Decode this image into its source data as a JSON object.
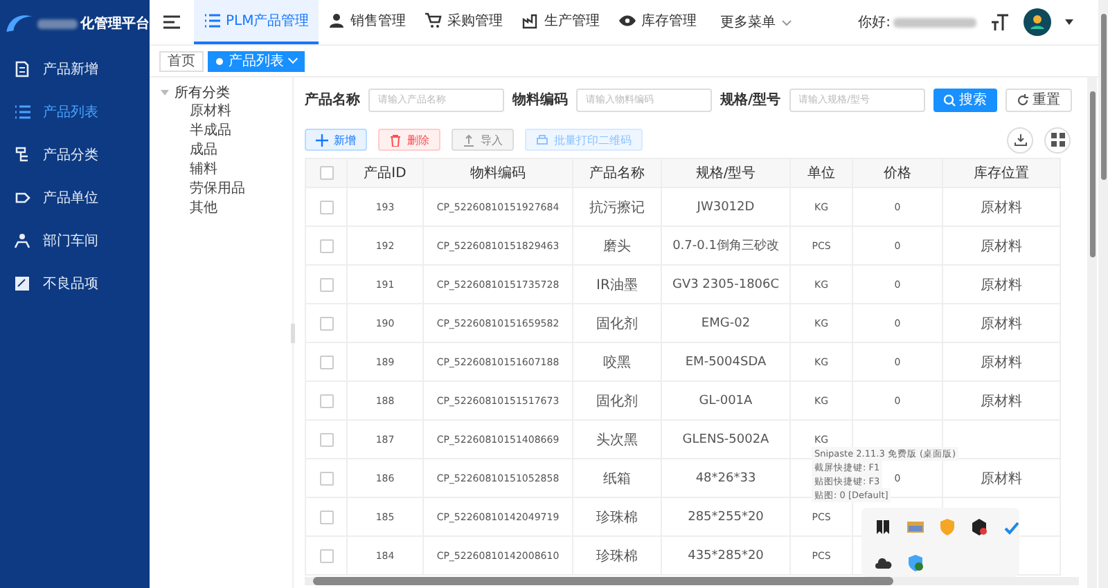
{
  "sidebar": {
    "logo_text": "化管理平台",
    "items": [
      {
        "label": "产品新增",
        "selected": false
      },
      {
        "label": "产品列表",
        "selected": true
      },
      {
        "label": "产品分类",
        "selected": false
      },
      {
        "label": "产品单位",
        "selected": false
      },
      {
        "label": "部门车间",
        "selected": false
      },
      {
        "label": "不良品项",
        "selected": false
      }
    ]
  },
  "topnav": {
    "items": [
      {
        "label": "PLM产品管理",
        "selected": true
      },
      {
        "label": "销售管理",
        "selected": false
      },
      {
        "label": "采购管理",
        "selected": false
      },
      {
        "label": "生产管理",
        "selected": false
      },
      {
        "label": "库存管理",
        "selected": false
      }
    ],
    "more_menu": "更多菜单",
    "greeting": "你好:"
  },
  "tabs": [
    {
      "label": "首页",
      "selected": false
    },
    {
      "label": "产品列表",
      "selected": true
    }
  ],
  "tree": {
    "label": "所有分类",
    "expanded": true,
    "children": [
      {
        "label": "原材料"
      },
      {
        "label": "半成品"
      },
      {
        "label": "成品"
      },
      {
        "label": "辅料"
      },
      {
        "label": "劳保用品"
      },
      {
        "label": "其他"
      }
    ]
  },
  "search": {
    "fields": [
      {
        "label": "产品名称",
        "placeholder": "请输入产品名称"
      },
      {
        "label": "物料编码",
        "placeholder": "请输入物料编码"
      },
      {
        "label": "规格/型号",
        "placeholder": "请输入规格/型号"
      }
    ],
    "search_button": "搜索",
    "reset_button": "重置"
  },
  "actions": [
    {
      "label": "新增",
      "kind": "add"
    },
    {
      "label": "删除",
      "kind": "delete"
    },
    {
      "label": "导入",
      "kind": "import"
    },
    {
      "label": "批量打印二维码",
      "kind": "print"
    }
  ],
  "table": {
    "header_checked": false,
    "columns": [
      "产品ID",
      "物料编码",
      "产品名称",
      "规格/型号",
      "单位",
      "价格",
      "库存位置"
    ],
    "rows": [
      {
        "checked": false,
        "cells": [
          "193",
          "CP_52260810151927684",
          "抗污擦记",
          "JW3012D",
          "KG",
          "0",
          "原材料"
        ]
      },
      {
        "checked": false,
        "cells": [
          "192",
          "CP_52260810151829463",
          "磨头",
          "0.7-0.1倒角三砂改",
          "PCS",
          "0",
          "原材料"
        ]
      },
      {
        "checked": false,
        "cells": [
          "191",
          "CP_52260810151735728",
          "IR油墨",
          "GV3 2305-1806C",
          "KG",
          "0",
          "原材料"
        ]
      },
      {
        "checked": false,
        "cells": [
          "190",
          "CP_52260810151659582",
          "固化剂",
          "EMG-02",
          "KG",
          "0",
          "原材料"
        ]
      },
      {
        "checked": false,
        "cells": [
          "189",
          "CP_52260810151607188",
          "咬黑",
          "EM-5004SDA",
          "KG",
          "0",
          "原材料"
        ]
      },
      {
        "checked": false,
        "cells": [
          "188",
          "CP_52260810151517673",
          "固化剂",
          "GL-001A",
          "KG",
          "0",
          "原材料"
        ]
      },
      {
        "checked": false,
        "cells": [
          "187",
          "CP_52260810151408669",
          "头次黑",
          "GLENS-5002A",
          "KG"
        ]
      },
      {
        "checked": false,
        "cells": [
          "186",
          "CP_52260810151052858",
          "纸箱",
          "48*26*33",
          null,
          "0",
          "原材料"
        ]
      },
      {
        "checked": false,
        "cells": [
          "185",
          "CP_52260810142049719",
          "珍珠棉",
          "285*255*20",
          "PCS"
        ]
      },
      {
        "checked": false,
        "cells": [
          "184",
          "CP_52260810142008610",
          "珍珠棉",
          "435*285*20",
          "PCS"
        ]
      }
    ]
  },
  "tooltip": {
    "lines": [
      "Snipaste 2.11.3 免费版 (桌面版)",
      "截屏快捷键: F1",
      "贴图快捷键: F3",
      "贴图: 0 [Default]"
    ]
  },
  "tray": {
    "icons": [
      {
        "kind": "bookmark"
      },
      {
        "kind": "window"
      },
      {
        "kind": "shield"
      },
      {
        "kind": "cube"
      },
      {
        "kind": "check"
      },
      {
        "kind": "cloud"
      },
      {
        "kind": "badge"
      }
    ]
  }
}
